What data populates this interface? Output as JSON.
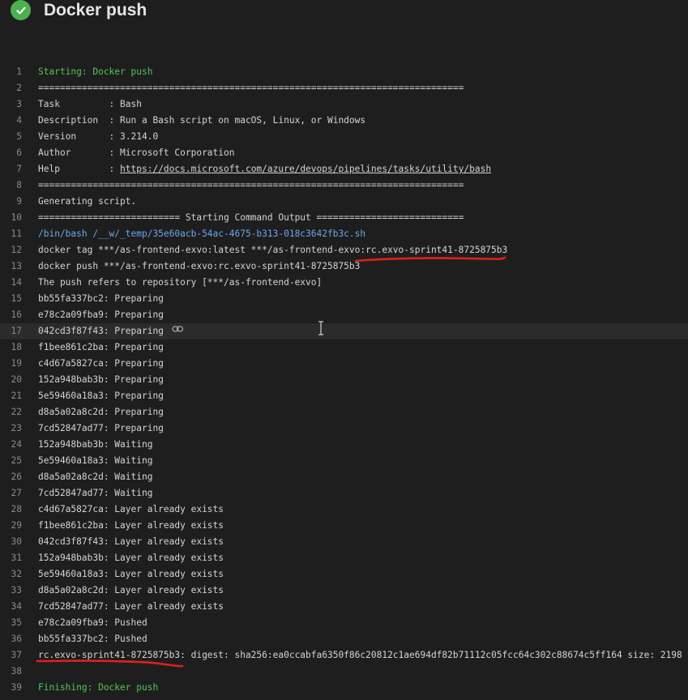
{
  "header": {
    "title": "Docker push",
    "status": "succeeded",
    "status_icon": "checkmark-icon"
  },
  "log": {
    "lines": [
      {
        "n": "1",
        "text": "Starting: Docker push"
      },
      {
        "n": "2",
        "text": "=============================================================================="
      },
      {
        "n": "3",
        "text": "Task         : Bash"
      },
      {
        "n": "4",
        "text": "Description  : Run a Bash script on macOS, Linux, or Windows"
      },
      {
        "n": "5",
        "text": "Version      : 3.214.0"
      },
      {
        "n": "6",
        "text": "Author       : Microsoft Corporation"
      },
      {
        "n": "7",
        "prefix": "Help         : ",
        "link": "https://docs.microsoft.com/azure/devops/pipelines/tasks/utility/bash"
      },
      {
        "n": "8",
        "text": "=============================================================================="
      },
      {
        "n": "9",
        "text": "Generating script."
      },
      {
        "n": "10",
        "text": "========================== Starting Command Output ==========================="
      },
      {
        "n": "11",
        "text": "/bin/bash /__w/_temp/35e60acb-54ac-4675-b313-018c3642fb3c.sh"
      },
      {
        "n": "12",
        "text": "docker tag ***/as-frontend-exvo:latest ***/as-frontend-exvo:rc.exvo-sprint41-8725875b3"
      },
      {
        "n": "13",
        "text": "docker push ***/as-frontend-exvo:rc.exvo-sprint41-8725875b3"
      },
      {
        "n": "14",
        "text": "The push refers to repository [***/as-frontend-exvo]"
      },
      {
        "n": "15",
        "text": "bb55fa337bc2: Preparing"
      },
      {
        "n": "16",
        "text": "e78c2a09fba9: Preparing"
      },
      {
        "n": "17",
        "text": "042cd3f87f43: Preparing"
      },
      {
        "n": "18",
        "text": "f1bee861c2ba: Preparing"
      },
      {
        "n": "19",
        "text": "c4d67a5827ca: Preparing"
      },
      {
        "n": "20",
        "text": "152a948bab3b: Preparing"
      },
      {
        "n": "21",
        "text": "5e59460a18a3: Preparing"
      },
      {
        "n": "22",
        "text": "d8a5a02a8c2d: Preparing"
      },
      {
        "n": "23",
        "text": "7cd52847ad77: Preparing"
      },
      {
        "n": "24",
        "text": "152a948bab3b: Waiting"
      },
      {
        "n": "25",
        "text": "5e59460a18a3: Waiting"
      },
      {
        "n": "26",
        "text": "d8a5a02a8c2d: Waiting"
      },
      {
        "n": "27",
        "text": "7cd52847ad77: Waiting"
      },
      {
        "n": "28",
        "text": "c4d67a5827ca: Layer already exists"
      },
      {
        "n": "29",
        "text": "f1bee861c2ba: Layer already exists"
      },
      {
        "n": "30",
        "text": "042cd3f87f43: Layer already exists"
      },
      {
        "n": "31",
        "text": "152a948bab3b: Layer already exists"
      },
      {
        "n": "32",
        "text": "5e59460a18a3: Layer already exists"
      },
      {
        "n": "33",
        "text": "d8a5a02a8c2d: Layer already exists"
      },
      {
        "n": "34",
        "text": "7cd52847ad77: Layer already exists"
      },
      {
        "n": "35",
        "text": "e78c2a09fba9: Pushed"
      },
      {
        "n": "36",
        "text": "bb55fa337bc2: Pushed"
      },
      {
        "n": "37",
        "text": "rc.exvo-sprint41-8725875b3: digest: sha256:ea0ccabfa6350f86c20812c1ae694df82b71112c05fcc64c302c88674c5ff164 size: 2198"
      },
      {
        "n": "38",
        "text": ""
      },
      {
        "n": "39",
        "text": "Finishing: Docker push"
      }
    ]
  },
  "colors": {
    "background": "#1e1e1e",
    "success": "#4caf50",
    "log_green": "#55c45a",
    "log_blue": "#6aa8e8",
    "annotation_red": "#e0201b"
  }
}
